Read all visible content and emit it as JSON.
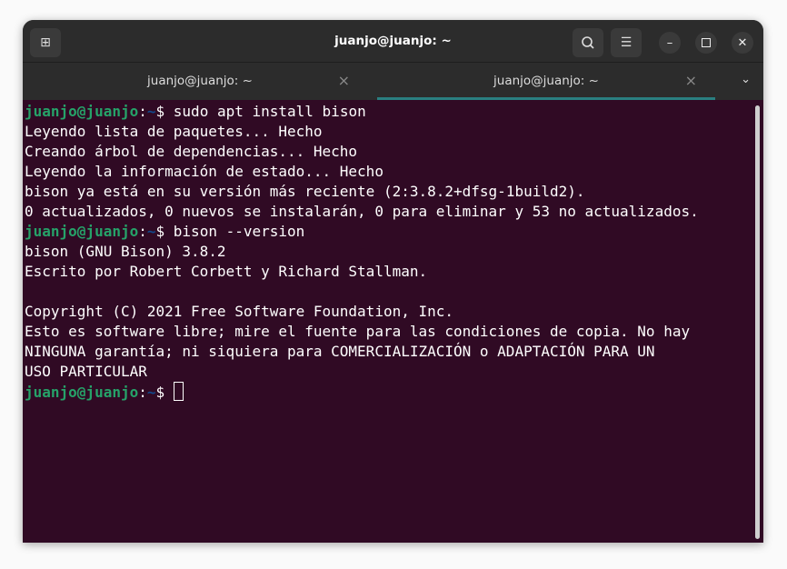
{
  "window": {
    "title": "juanjo@juanjo: ~"
  },
  "tabs": [
    {
      "label": "juanjo@juanjo: ~",
      "active": false
    },
    {
      "label": "juanjo@juanjo: ~",
      "active": true
    }
  ],
  "prompt": {
    "user": "juanjo@juanjo",
    "sep": ":",
    "path": "~",
    "sym": "$"
  },
  "lines": [
    {
      "type": "cmd",
      "text": " sudo apt install bison"
    },
    {
      "type": "out",
      "text": "Leyendo lista de paquetes... Hecho"
    },
    {
      "type": "out",
      "text": "Creando árbol de dependencias... Hecho"
    },
    {
      "type": "out",
      "text": "Leyendo la información de estado... Hecho"
    },
    {
      "type": "out",
      "text": "bison ya está en su versión más reciente (2:3.8.2+dfsg-1build2)."
    },
    {
      "type": "out",
      "text": "0 actualizados, 0 nuevos se instalarán, 0 para eliminar y 53 no actualizados."
    },
    {
      "type": "cmd",
      "text": " bison --version"
    },
    {
      "type": "out",
      "text": "bison (GNU Bison) 3.8.2"
    },
    {
      "type": "out",
      "text": "Escrito por Robert Corbett y Richard Stallman."
    },
    {
      "type": "out",
      "text": ""
    },
    {
      "type": "out",
      "text": "Copyright (C) 2021 Free Software Foundation, Inc."
    },
    {
      "type": "out",
      "text": "Esto es software libre; mire el fuente para las condiciones de copia. No hay"
    },
    {
      "type": "out",
      "text": "NINGUNA garantía; ni siquiera para COMERCIALIZACIÓN o ADAPTACIÓN PARA UN"
    },
    {
      "type": "out",
      "text": "USO PARTICULAR"
    },
    {
      "type": "cmd",
      "text": " "
    }
  ]
}
